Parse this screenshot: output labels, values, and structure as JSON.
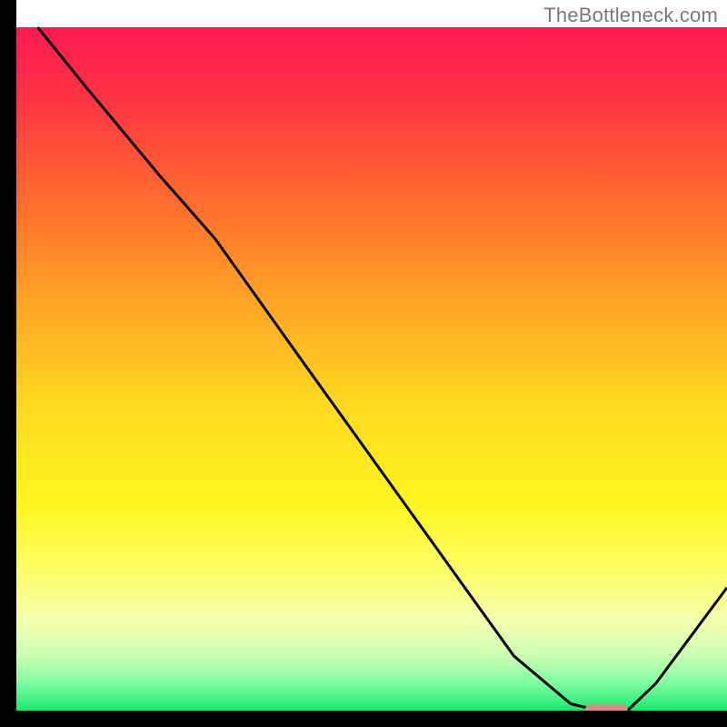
{
  "watermark": "TheBottleneck.com",
  "chart_data": {
    "type": "line",
    "title": "",
    "xlabel": "",
    "ylabel": "",
    "xlim": [
      0,
      100
    ],
    "ylim": [
      0,
      100
    ],
    "grid": false,
    "legend": false,
    "series": [
      {
        "name": "curve",
        "x": [
          3,
          10,
          20,
          28,
          40,
          50,
          60,
          70,
          78,
          82,
          86,
          90,
          100
        ],
        "values": [
          100,
          91,
          78.5,
          69,
          51.5,
          37,
          22.5,
          8,
          1,
          0,
          0,
          4,
          18
        ]
      }
    ],
    "marker": {
      "name": "minimum-marker",
      "xrange": [
        80,
        86
      ],
      "y": 0,
      "color": "#d98a8a"
    },
    "background_gradient": {
      "stops": [
        {
          "offset": 0.0,
          "color": "#ff1a52"
        },
        {
          "offset": 0.1,
          "color": "#ff3144"
        },
        {
          "offset": 0.25,
          "color": "#ff6a2e"
        },
        {
          "offset": 0.4,
          "color": "#ffa425"
        },
        {
          "offset": 0.55,
          "color": "#ffd81f"
        },
        {
          "offset": 0.7,
          "color": "#fff61f"
        },
        {
          "offset": 0.8,
          "color": "#fdff6b"
        },
        {
          "offset": 0.87,
          "color": "#f5ffb0"
        },
        {
          "offset": 0.92,
          "color": "#c9ffb3"
        },
        {
          "offset": 0.96,
          "color": "#7dffa1"
        },
        {
          "offset": 1.0,
          "color": "#17e86a"
        }
      ]
    }
  }
}
